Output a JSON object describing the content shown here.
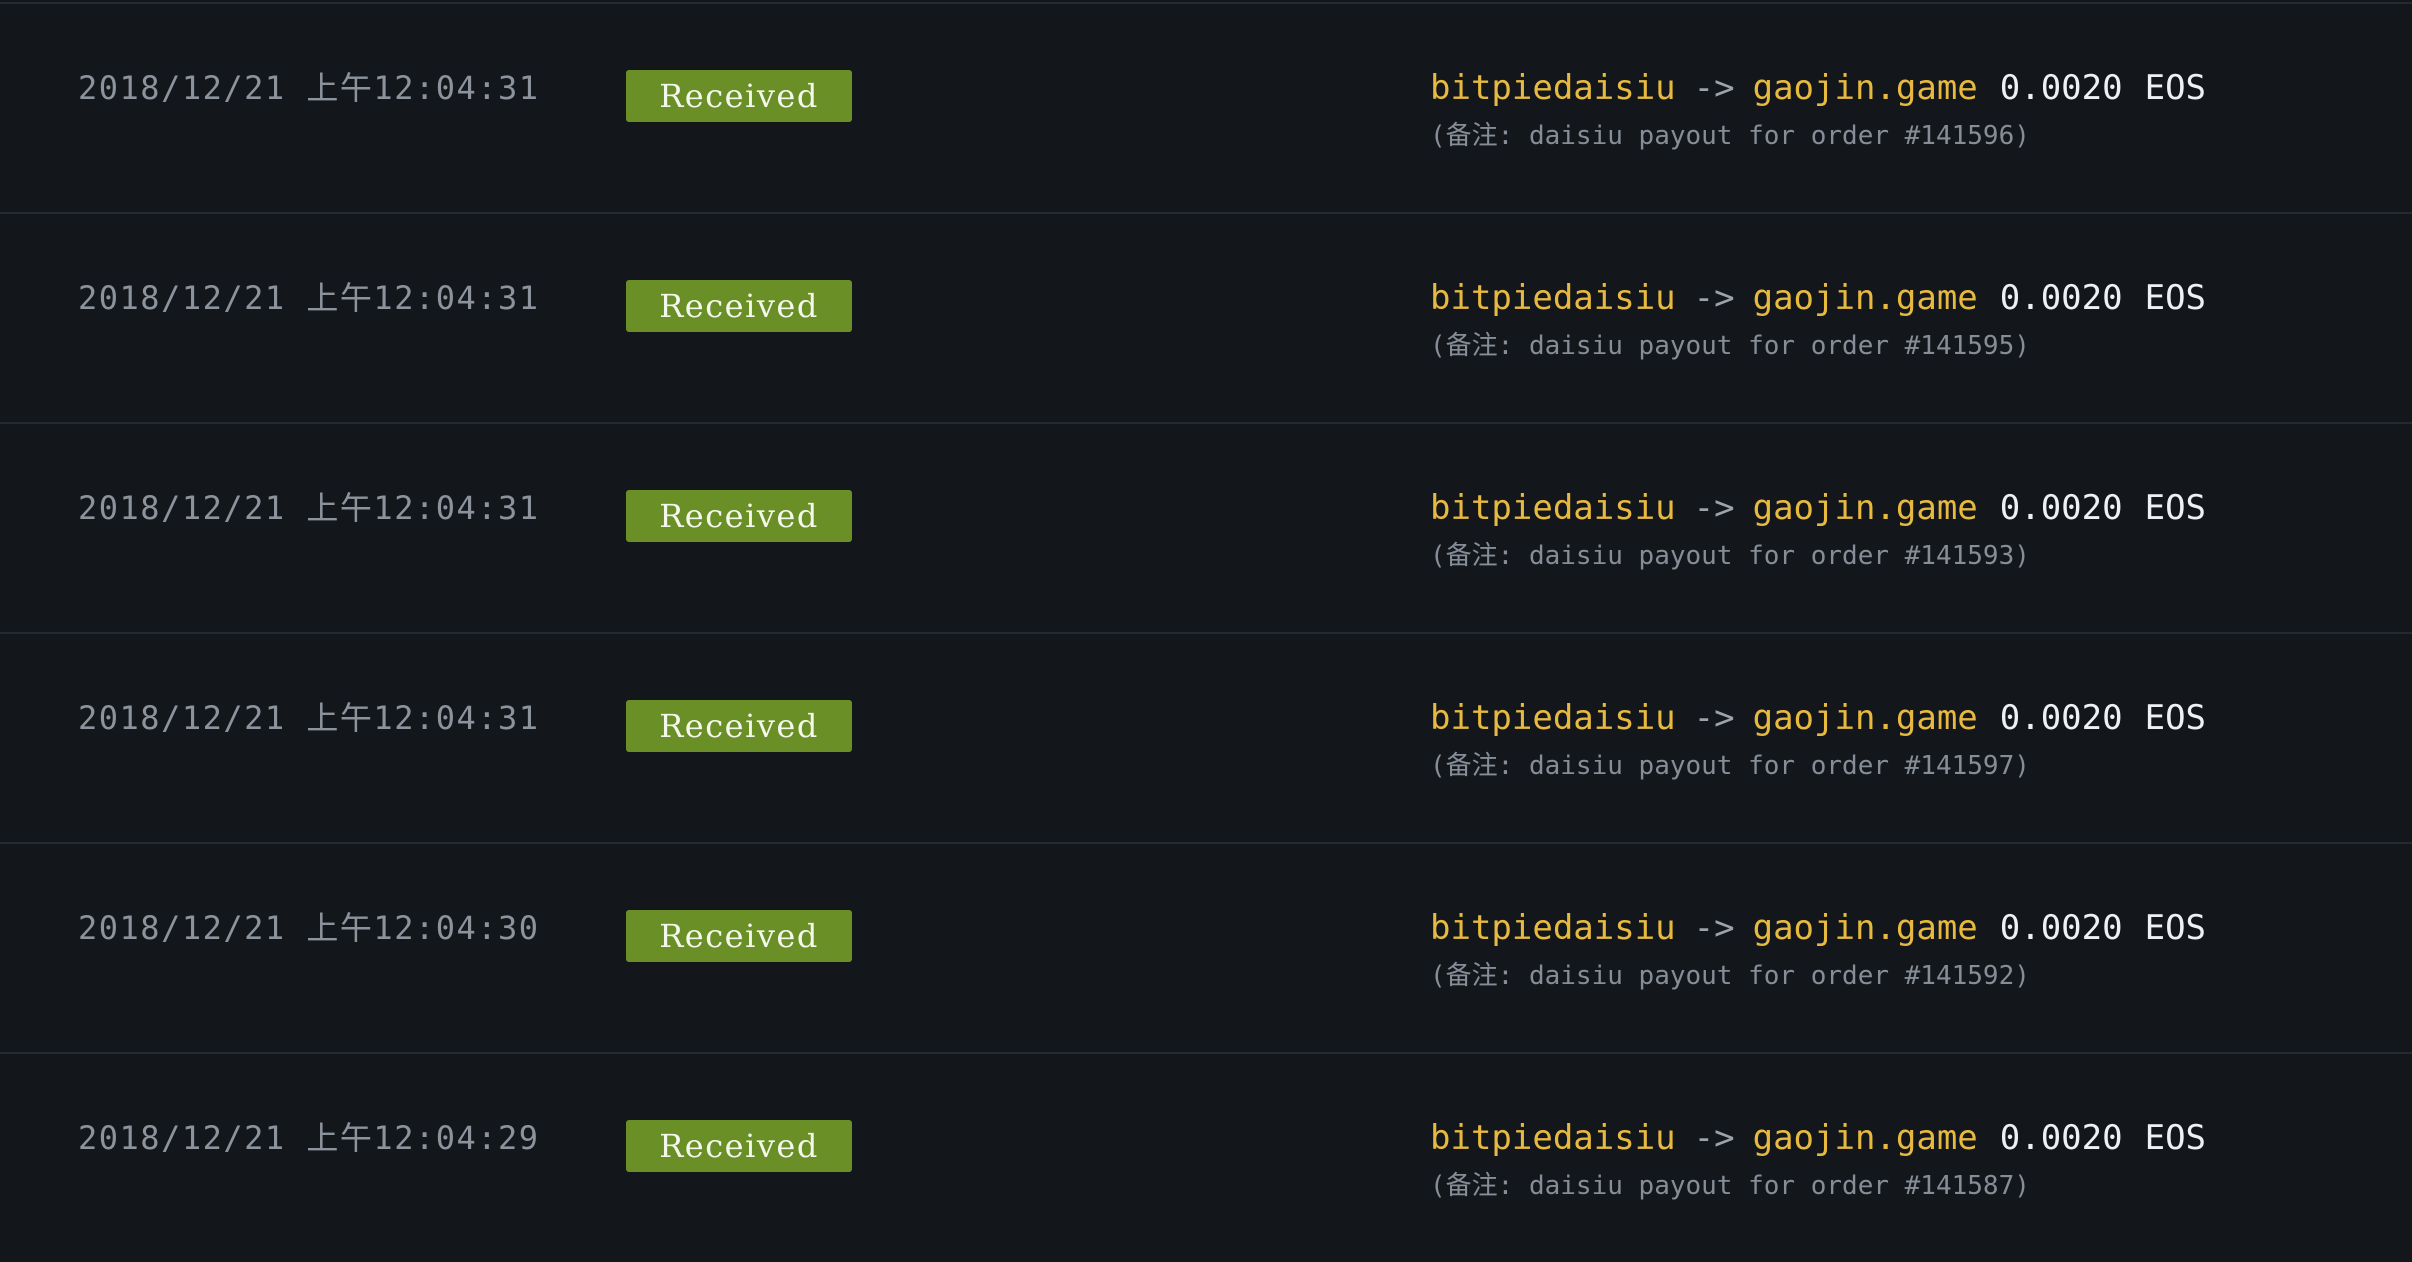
{
  "status_badge_color": "#6a8f27",
  "account_color": "#e7b93e",
  "arrow_symbol": "->",
  "memo_prefix": "(备注: ",
  "memo_suffix": ")",
  "transactions": [
    {
      "time": "2018/12/21 上午12:04:31",
      "status": "Received",
      "from": "bitpiedaisiu",
      "to": "gaojin.game",
      "amount": "0.0020",
      "symbol": "EOS",
      "memo": "daisiu payout for order #141596"
    },
    {
      "time": "2018/12/21 上午12:04:31",
      "status": "Received",
      "from": "bitpiedaisiu",
      "to": "gaojin.game",
      "amount": "0.0020",
      "symbol": "EOS",
      "memo": "daisiu payout for order #141595"
    },
    {
      "time": "2018/12/21 上午12:04:31",
      "status": "Received",
      "from": "bitpiedaisiu",
      "to": "gaojin.game",
      "amount": "0.0020",
      "symbol": "EOS",
      "memo": "daisiu payout for order #141593"
    },
    {
      "time": "2018/12/21 上午12:04:31",
      "status": "Received",
      "from": "bitpiedaisiu",
      "to": "gaojin.game",
      "amount": "0.0020",
      "symbol": "EOS",
      "memo": "daisiu payout for order #141597"
    },
    {
      "time": "2018/12/21 上午12:04:30",
      "status": "Received",
      "from": "bitpiedaisiu",
      "to": "gaojin.game",
      "amount": "0.0020",
      "symbol": "EOS",
      "memo": "daisiu payout for order #141592"
    },
    {
      "time": "2018/12/21 上午12:04:29",
      "status": "Received",
      "from": "bitpiedaisiu",
      "to": "gaojin.game",
      "amount": "0.0020",
      "symbol": "EOS",
      "memo": "daisiu payout for order #141587"
    }
  ]
}
